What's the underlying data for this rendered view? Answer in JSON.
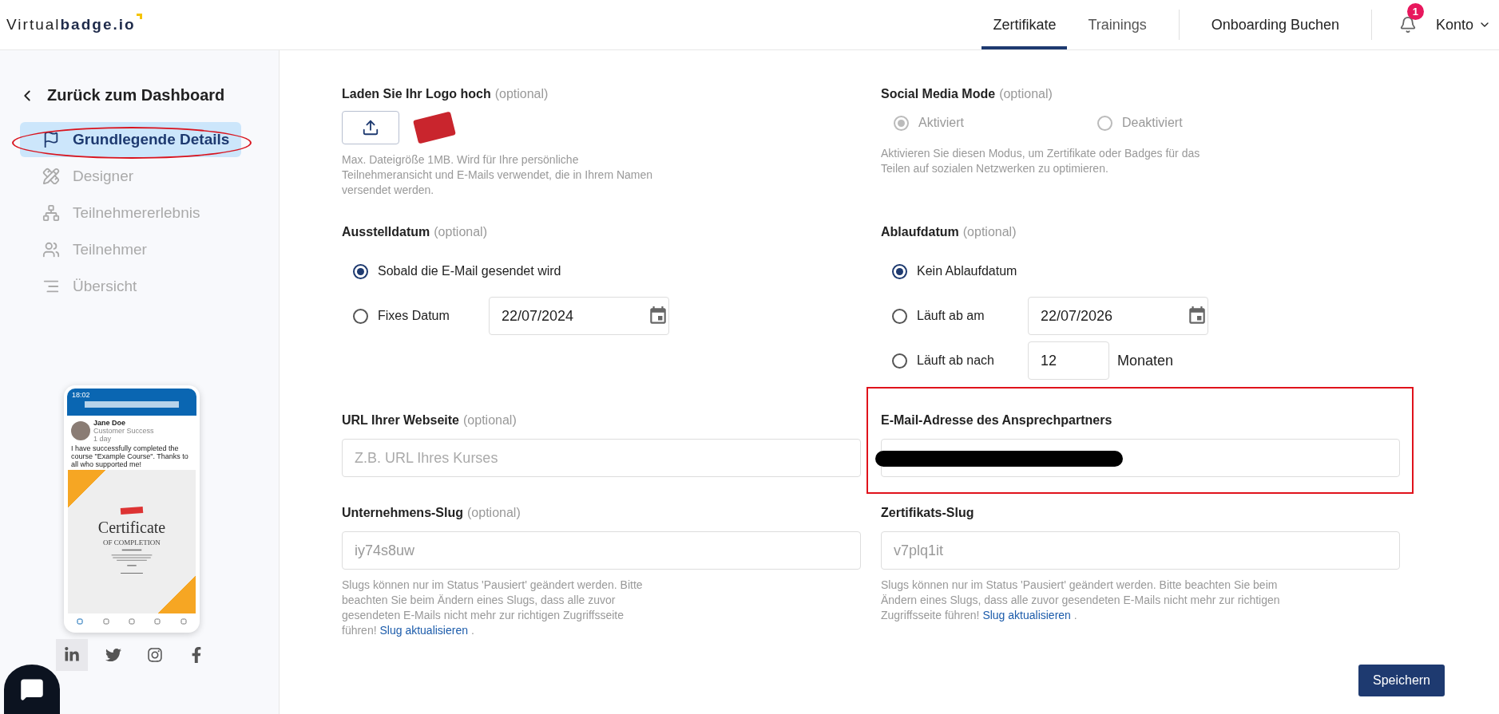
{
  "header": {
    "logo": {
      "light": "Virtual",
      "bold": "badge.io"
    },
    "nav": [
      {
        "label": "Zertifikate",
        "selected": true
      },
      {
        "label": "Trainings",
        "selected": false
      }
    ],
    "onboarding": "Onboarding Buchen",
    "notifications": "1",
    "account": "Konto"
  },
  "sidebar": {
    "back": "Zurück zum Dashboard",
    "items": [
      {
        "label": "Grundlegende Details",
        "selected": true,
        "circled": true
      },
      {
        "label": "Designer",
        "selected": false,
        "circled": false
      },
      {
        "label": "Teilnehmererlebnis",
        "selected": false,
        "circled": false
      },
      {
        "label": "Teilnehmer",
        "selected": false,
        "circled": false
      },
      {
        "label": "Übersicht",
        "selected": false,
        "circled": false
      }
    ],
    "preview": {
      "time": "18:02",
      "name": "Jane Doe",
      "role": "Customer Success",
      "age": "1 day",
      "post": "I have successfully completed the course \"Example Course\". Thanks to all who supported me!",
      "certificate_title": "Certificate",
      "certificate_subtitle": "OF COMPLETION"
    }
  },
  "form": {
    "logo": {
      "label": "Laden Sie Ihr Logo hoch",
      "optional": "(optional)",
      "help": "Max. Dateigröße 1MB. Wird für Ihre persönliche Teilnehmeransicht und E-Mails verwendet, die in Ihrem Namen versendet werden."
    },
    "social_mode": {
      "label": "Social Media Mode",
      "optional": "(optional)",
      "disabled": true,
      "options": [
        {
          "label": "Aktiviert",
          "selected": true
        },
        {
          "label": "Deaktiviert",
          "selected": false
        }
      ],
      "help": "Aktivieren Sie diesen Modus, um Zertifikate oder Badges für das Teilen auf sozialen Netzwerken zu optimieren."
    },
    "issue_date": {
      "label": "Ausstelldatum",
      "optional": "(optional)",
      "options": [
        {
          "kind": "plain",
          "label": "Sobald die E-Mail gesendet wird",
          "selected": true
        },
        {
          "kind": "date",
          "label": "Fixes Datum",
          "selected": false,
          "value": "22/07/2024"
        }
      ]
    },
    "expiry_date": {
      "label": "Ablaufdatum",
      "optional": "(optional)",
      "options": [
        {
          "kind": "plain",
          "label": "Kein Ablaufdatum",
          "selected": true
        },
        {
          "kind": "date",
          "label": "Läuft ab am",
          "selected": false,
          "value": "22/07/2026"
        },
        {
          "kind": "months",
          "label": "Läuft ab nach",
          "selected": false,
          "value": "12",
          "unit": "Monaten"
        }
      ]
    },
    "website": {
      "label": "URL Ihrer Webseite",
      "optional": "(optional)",
      "placeholder": "Z.B. URL Ihres Kurses"
    },
    "contact_email": {
      "label": "E-Mail-Adresse des Ansprechpartners",
      "redacted": true,
      "boxed": true
    },
    "company_slug": {
      "label": "Unternehmens-Slug",
      "optional": "(optional)",
      "value": "iy74s8uw",
      "disabled": true,
      "help": "Slugs können nur im Status 'Pausiert' geändert werden. Bitte beachten Sie beim Ändern eines Slugs, dass alle zuvor gesendeten E-Mails nicht mehr zur richtigen Zugriffsseite führen!",
      "link": "Slug aktualisieren",
      "after_link": "."
    },
    "certificate_slug": {
      "label": "Zertifikats-Slug",
      "value": "v7plq1it",
      "disabled": true,
      "help": "Slugs können nur im Status 'Pausiert' geändert werden. Bitte beachten Sie beim Ändern eines Slugs, dass alle zuvor gesendeten E-Mails nicht mehr zur richtigen Zugriffsseite führen!",
      "link": "Slug aktualisieren",
      "after_link": "."
    },
    "save": "Speichern"
  }
}
